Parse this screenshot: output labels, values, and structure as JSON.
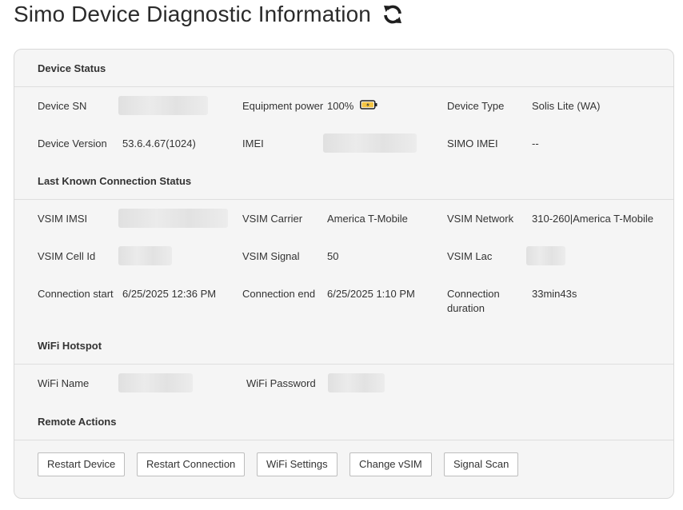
{
  "page": {
    "title": "Simo Device Diagnostic Information",
    "refresh_icon": "refresh-icon"
  },
  "device_status": {
    "heading": "Device Status",
    "device_sn_label": "Device SN",
    "equipment_power_label": "Equipment power",
    "equipment_power_value": "100%",
    "battery_level": 1.0,
    "device_type_label": "Device Type",
    "device_type_value": "Solis Lite (WA)",
    "device_version_label": "Device Version",
    "device_version_value": "53.6.4.67(1024)",
    "imei_label": "IMEI",
    "simo_imei_label": "SIMO IMEI",
    "simo_imei_value": "--"
  },
  "connection_status": {
    "heading": "Last Known Connection Status",
    "vsim_imsi_label": "VSIM IMSI",
    "vsim_carrier_label": "VSIM Carrier",
    "vsim_carrier_value": "America T-Mobile",
    "vsim_network_label": "VSIM Network",
    "vsim_network_value": "310-260|America T-Mobile",
    "vsim_cell_id_label": "VSIM Cell Id",
    "vsim_signal_label": "VSIM Signal",
    "vsim_signal_value": "50",
    "vsim_lac_label": "VSIM Lac",
    "connection_start_label": "Connection start",
    "connection_start_value": "6/25/2025 12:36 PM",
    "connection_end_label": "Connection end",
    "connection_end_value": "6/25/2025 1:10 PM",
    "connection_duration_label": "Connection duration",
    "connection_duration_value": "33min43s"
  },
  "wifi_hotspot": {
    "heading": "WiFi Hotspot",
    "wifi_name_label": "WiFi Name",
    "wifi_password_label": "WiFi Password"
  },
  "remote_actions": {
    "heading": "Remote Actions",
    "buttons": [
      "Restart Device",
      "Restart Connection",
      "WiFi Settings",
      "Change vSIM",
      "Signal Scan"
    ]
  },
  "colors": {
    "panel_background": "#f5f5f5",
    "border": "#d9d9d9",
    "text": "#333333",
    "battery_charge": "#f5c542"
  }
}
